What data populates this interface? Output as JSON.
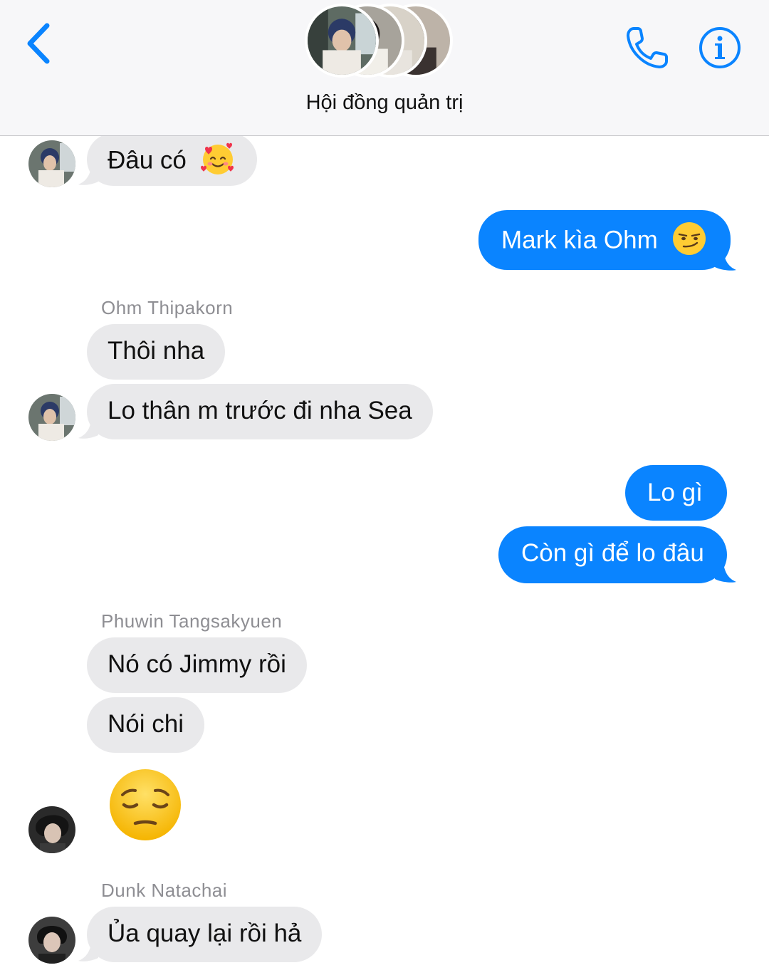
{
  "header": {
    "title": "Hội đồng quản trị",
    "back_icon": "chevron-left-icon",
    "call_icon": "phone-icon",
    "info_icon": "info-icon",
    "accent_color": "#0a84ff"
  },
  "messages": [
    {
      "direction": "in",
      "text": "Đâu có",
      "emoji": "smiling-face-with-hearts-emoji"
    },
    {
      "direction": "out",
      "text": "Mark kìa Ohm",
      "emoji": "smirking-face-emoji"
    },
    {
      "sender": "Ohm Thipakorn"
    },
    {
      "direction": "in",
      "text": "Thôi nha"
    },
    {
      "direction": "in",
      "text": "Lo thân m trước đi nha Sea"
    },
    {
      "direction": "out",
      "text": "Lo gì"
    },
    {
      "direction": "out",
      "text": "Còn gì để lo đâu"
    },
    {
      "sender": "Phuwin Tangsakyuen"
    },
    {
      "direction": "in",
      "text": "Nó có Jimmy rồi"
    },
    {
      "direction": "in",
      "text": "Nói chi"
    },
    {
      "direction": "in",
      "emoji": "pensive-face-emoji"
    },
    {
      "sender": "Dunk Natachai"
    },
    {
      "direction": "in",
      "text": "Ủa quay lại rồi hả"
    }
  ],
  "colors": {
    "incoming_bubble": "#e9e9eb",
    "outgoing_bubble": "#0a84ff",
    "sender_name": "#8e8e93"
  }
}
